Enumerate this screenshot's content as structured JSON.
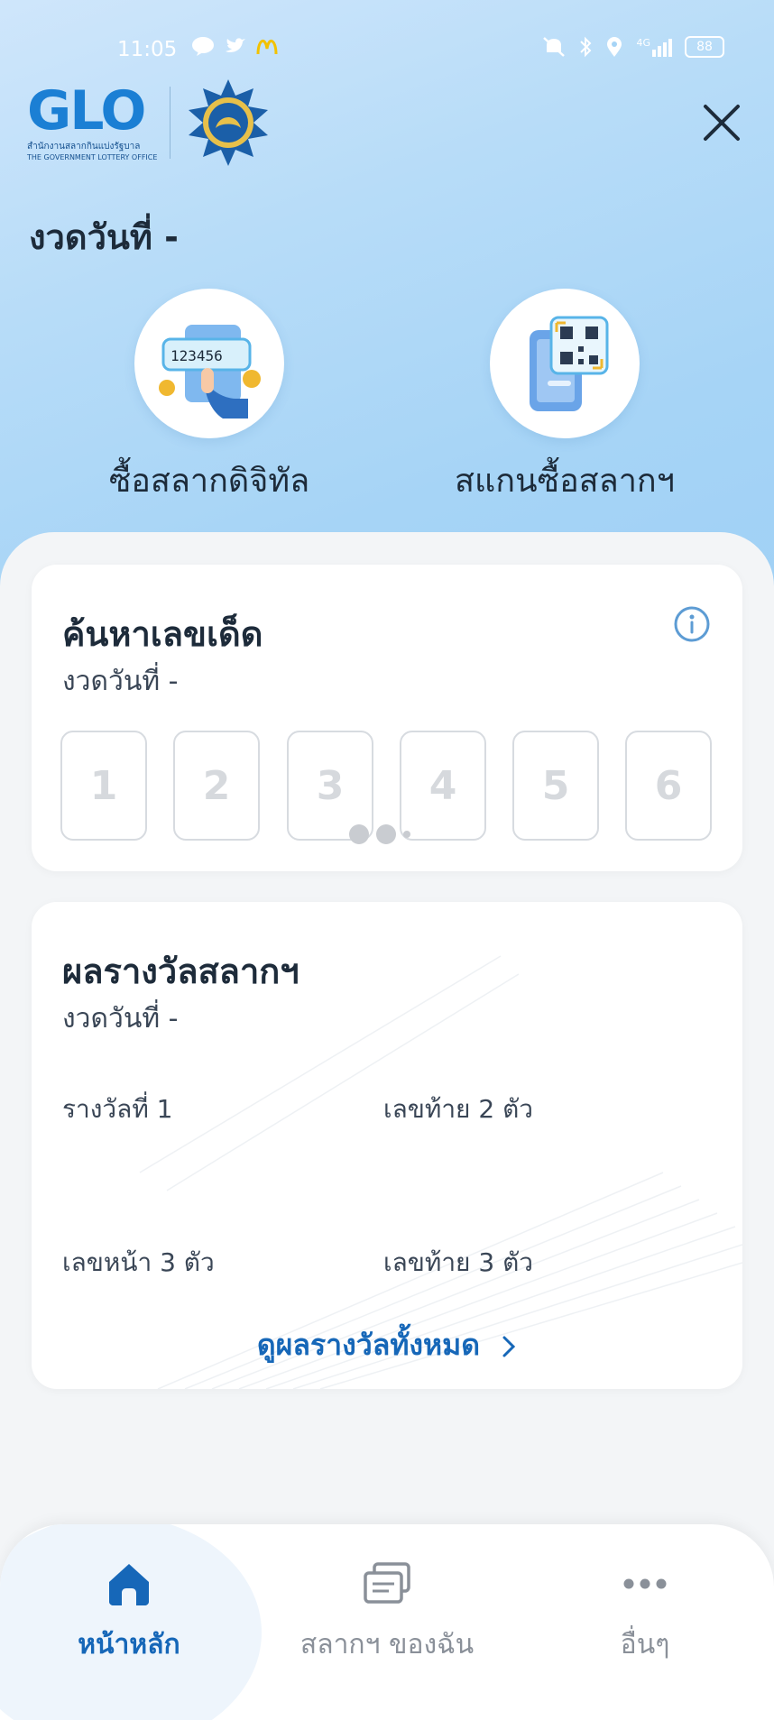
{
  "status_bar": {
    "time": "11:05",
    "network": "4G",
    "battery": "88"
  },
  "header": {
    "logo_text": "GLO",
    "logo_subtitle_th": "สำนักงานสลากกินแบ่งรัฐบาล",
    "logo_subtitle_en": "THE GOVERNMENT LOTTERY OFFICE",
    "draw_date_label": "งวดวันที่ -"
  },
  "actions": [
    {
      "label": "ซื้อสลากดิจิทัล",
      "ticket_number": "123456"
    },
    {
      "label": "สแกนซื้อสลากฯ"
    }
  ],
  "search_card": {
    "title": "ค้นหาเลขเด็ด",
    "subtitle": "งวดวันที่  -",
    "digits": [
      "1",
      "2",
      "3",
      "4",
      "5",
      "6"
    ]
  },
  "results_card": {
    "title": "ผลรางวัลสลากฯ",
    "subtitle": "งวดวันที่  -",
    "prize_1": "รางวัลที่ 1",
    "last_2": "เลขท้าย 2 ตัว",
    "first_3": "เลขหน้า 3 ตัว",
    "last_3": "เลขท้าย 3 ตัว",
    "see_all": "ดูผลรางวัลทั้งหมด"
  },
  "tabbar": {
    "tabs": [
      {
        "label": "หน้าหลัก",
        "icon": "home-icon",
        "active": true
      },
      {
        "label": "สลากฯ ของฉัน",
        "icon": "tickets-icon",
        "active": false
      },
      {
        "label": "อื่นๆ",
        "icon": "more-icon",
        "active": false
      }
    ]
  },
  "colors": {
    "primary": "#1667b8",
    "title": "#1d2b3a",
    "inactive": "#8a9099"
  }
}
